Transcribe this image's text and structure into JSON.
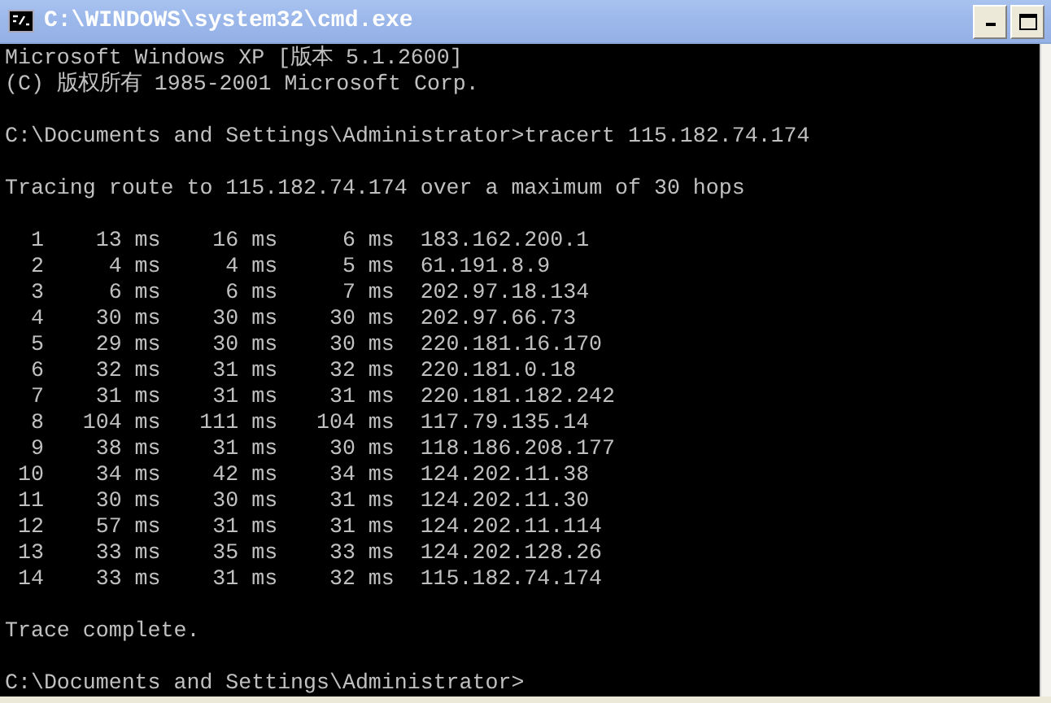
{
  "window": {
    "title": "C:\\WINDOWS\\system32\\cmd.exe"
  },
  "console": [
    {
      "kind": "line",
      "text": "Microsoft Windows XP [版本 5.1.2600]"
    },
    {
      "kind": "line",
      "text": "(C) 版权所有 1985-2001 Microsoft Corp."
    },
    {
      "kind": "gap"
    },
    {
      "kind": "line",
      "text": "C:\\Documents and Settings\\Administrator>tracert 115.182.74.174"
    },
    {
      "kind": "gap"
    },
    {
      "kind": "line",
      "text": "Tracing route to 115.182.74.174 over a maximum of 30 hops"
    },
    {
      "kind": "gap"
    },
    {
      "kind": "hop",
      "hop": "1",
      "times": [
        "13 ms",
        "16 ms",
        "6 ms"
      ],
      "address": "183.162.200.1"
    },
    {
      "kind": "hop",
      "hop": "2",
      "times": [
        "4 ms",
        "4 ms",
        "5 ms"
      ],
      "address": "61.191.8.9"
    },
    {
      "kind": "hop",
      "hop": "3",
      "times": [
        "6 ms",
        "6 ms",
        "7 ms"
      ],
      "address": "202.97.18.134"
    },
    {
      "kind": "hop",
      "hop": "4",
      "times": [
        "30 ms",
        "30 ms",
        "30 ms"
      ],
      "address": "202.97.66.73"
    },
    {
      "kind": "hop",
      "hop": "5",
      "times": [
        "29 ms",
        "30 ms",
        "30 ms"
      ],
      "address": "220.181.16.170"
    },
    {
      "kind": "hop",
      "hop": "6",
      "times": [
        "32 ms",
        "31 ms",
        "32 ms"
      ],
      "address": "220.181.0.18"
    },
    {
      "kind": "hop",
      "hop": "7",
      "times": [
        "31 ms",
        "31 ms",
        "31 ms"
      ],
      "address": "220.181.182.242"
    },
    {
      "kind": "hop",
      "hop": "8",
      "times": [
        "104 ms",
        "111 ms",
        "104 ms"
      ],
      "address": "117.79.135.14"
    },
    {
      "kind": "hop",
      "hop": "9",
      "times": [
        "38 ms",
        "31 ms",
        "30 ms"
      ],
      "address": "118.186.208.177"
    },
    {
      "kind": "hop",
      "hop": "10",
      "times": [
        "34 ms",
        "42 ms",
        "34 ms"
      ],
      "address": "124.202.11.38"
    },
    {
      "kind": "hop",
      "hop": "11",
      "times": [
        "30 ms",
        "30 ms",
        "31 ms"
      ],
      "address": "124.202.11.30"
    },
    {
      "kind": "hop",
      "hop": "12",
      "times": [
        "57 ms",
        "31 ms",
        "31 ms"
      ],
      "address": "124.202.11.114"
    },
    {
      "kind": "hop",
      "hop": "13",
      "times": [
        "33 ms",
        "35 ms",
        "33 ms"
      ],
      "address": "124.202.128.26"
    },
    {
      "kind": "hop",
      "hop": "14",
      "times": [
        "33 ms",
        "31 ms",
        "32 ms"
      ],
      "address": "115.182.74.174"
    },
    {
      "kind": "gap"
    },
    {
      "kind": "line",
      "text": "Trace complete."
    },
    {
      "kind": "gap"
    },
    {
      "kind": "line",
      "text": "C:\\Documents and Settings\\Administrator>"
    }
  ]
}
